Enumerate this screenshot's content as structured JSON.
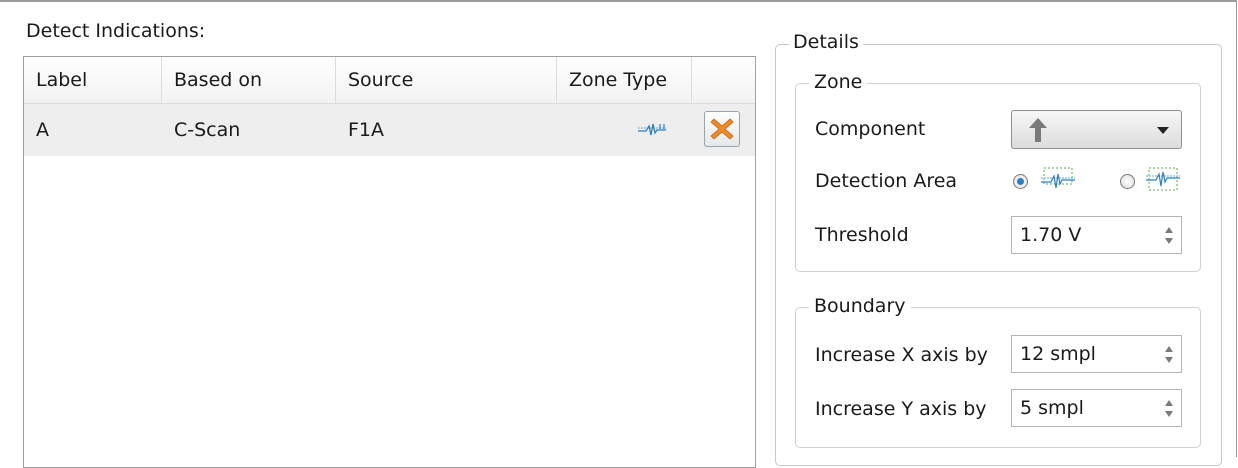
{
  "left_panel": {
    "title": "Detect Indications:",
    "columns": [
      "Label",
      "Based on",
      "Source",
      "Zone Type",
      ""
    ],
    "rows": [
      {
        "label": "A",
        "based_on": "C-Scan",
        "source": "F1A",
        "zone_type_icon": "waveform-zone-icon",
        "delete_icon": "delete-x-icon"
      }
    ]
  },
  "details": {
    "title": "Details",
    "zone": {
      "title": "Zone",
      "component_label": "Component",
      "component_value_icon": "arrow-up-icon",
      "detection_area_label": "Detection Area",
      "detection_area_options": [
        {
          "icon": "detection-area-gate-icon",
          "checked": true
        },
        {
          "icon": "detection-area-full-icon",
          "checked": false
        }
      ],
      "threshold_label": "Threshold",
      "threshold_value": "1.70 V"
    },
    "boundary": {
      "title": "Boundary",
      "x_label": "Increase X axis by",
      "x_value": "12 smpl",
      "y_label": "Increase Y axis by",
      "y_value": "5 smpl"
    }
  },
  "colors": {
    "accent": "#2f7fc0",
    "delete": "#f08a24",
    "selected_row": "#eeeeee"
  }
}
